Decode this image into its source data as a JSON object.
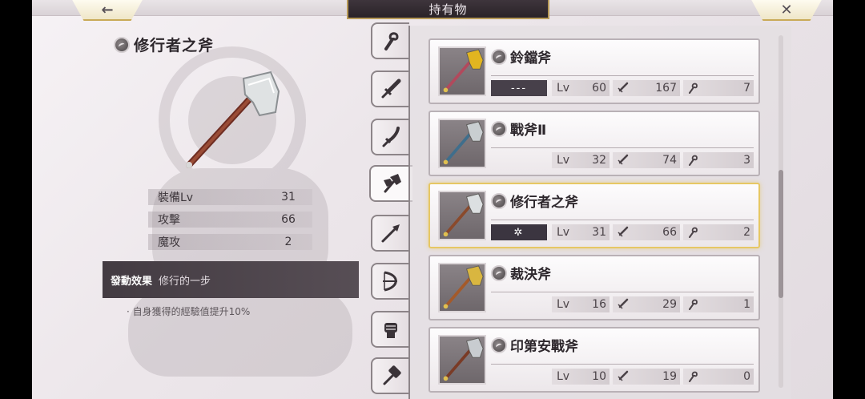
{
  "header": {
    "title": "持有物",
    "back_icon": "←",
    "close_icon": "✕"
  },
  "detail": {
    "name": "修行者之斧",
    "stats": [
      {
        "label": "裝備Lv",
        "value": "31"
      },
      {
        "label": "攻擊",
        "value": "66"
      },
      {
        "label": "魔攻",
        "value": "2"
      }
    ],
    "effect_title": "發動效果",
    "effect_name": "修行的一步",
    "effect_desc": "· 自身獲得的經驗值提升10%"
  },
  "tabs": [
    {
      "icon": "staff-icon"
    },
    {
      "icon": "sword-icon"
    },
    {
      "icon": "katana-icon"
    },
    {
      "icon": "axe-icon",
      "active": true
    },
    {
      "icon": "spear-icon"
    },
    {
      "icon": "bow-icon"
    },
    {
      "icon": "gauntlet-icon"
    },
    {
      "icon": "hammer-icon"
    }
  ],
  "items": [
    {
      "name": "鈴鐺斧",
      "tag": "---",
      "lv_label": "Lv",
      "lv": "60",
      "atk": "167",
      "matk": "7",
      "head_color": "#e2b520",
      "shaft_color": "#b2495c"
    },
    {
      "name": "戰斧Ⅱ",
      "tag": "",
      "lv_label": "Lv",
      "lv": "32",
      "atk": "74",
      "matk": "3",
      "head_color": "#c9ced1",
      "shaft_color": "#3f6e8c"
    },
    {
      "name": "修行者之斧",
      "tag": "✲",
      "lv_label": "Lv",
      "lv": "31",
      "atk": "66",
      "matk": "2",
      "head_color": "#dcdfe1",
      "shaft_color": "#8a4a2c",
      "selected": true
    },
    {
      "name": "裁決斧",
      "tag": "",
      "lv_label": "Lv",
      "lv": "16",
      "atk": "29",
      "matk": "1",
      "head_color": "#d9b640",
      "shaft_color": "#a45a2a"
    },
    {
      "name": "印第安戰斧",
      "tag": "",
      "lv_label": "Lv",
      "lv": "10",
      "atk": "19",
      "matk": "0",
      "head_color": "#c8ccd0",
      "shaft_color": "#7a3b26"
    }
  ],
  "colors": {
    "accent": "#e6c764",
    "panel_dark": "#433b42"
  }
}
